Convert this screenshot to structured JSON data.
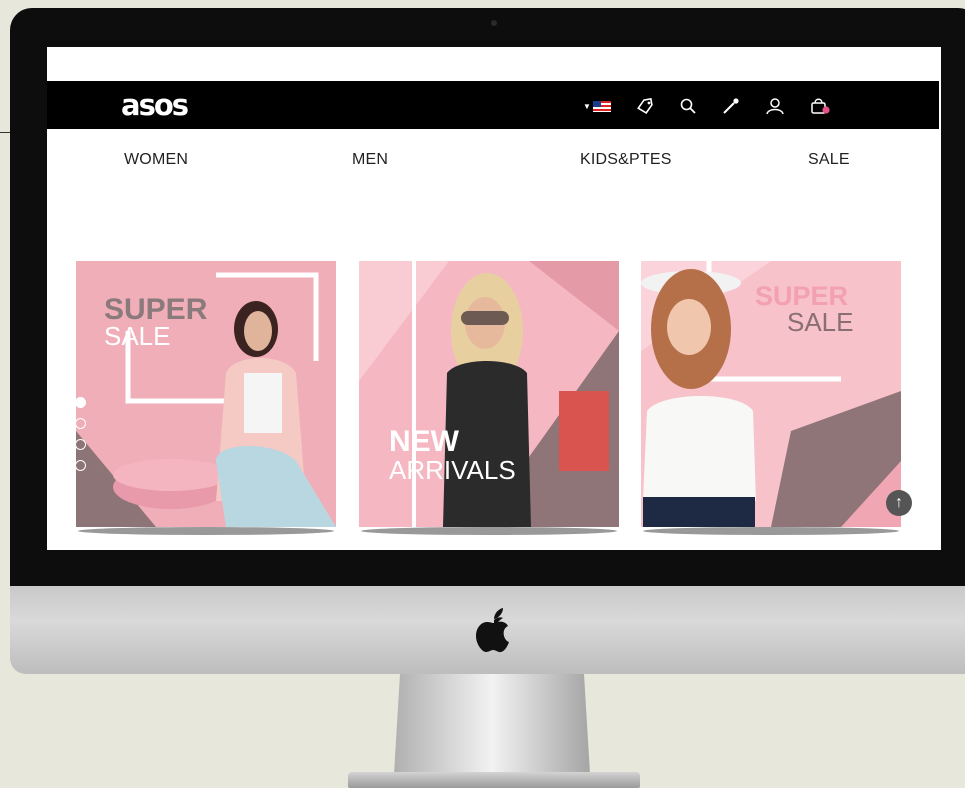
{
  "header": {
    "logo": "asos",
    "icons": [
      "country-flag-icon",
      "tag-icon",
      "search-icon",
      "pin-icon",
      "account-icon",
      "bag-icon"
    ]
  },
  "nav": {
    "items": [
      "WOMEN",
      "MEN",
      "KIDS&PTES",
      "SALE"
    ]
  },
  "banners": [
    {
      "line1": "SUPER",
      "line2": "SALE"
    },
    {
      "line1": "NEW",
      "line2": "ARRIVALS"
    },
    {
      "line1": "SUPER",
      "line2": "SALE"
    }
  ],
  "colors": {
    "topbar": "#000000",
    "accent_pink": "#f2b4bd",
    "bag_badge": "#e8508a"
  },
  "carousel": {
    "dots": 4,
    "active_index": 0
  }
}
